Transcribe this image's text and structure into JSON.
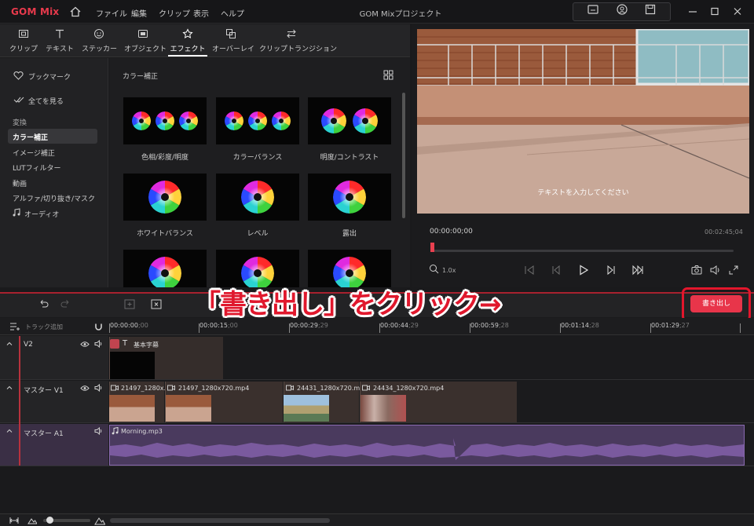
{
  "app": {
    "logo": "GOM Mix",
    "title": "GOM Mixプロジェクト"
  },
  "menu": [
    "ファイル",
    "編集",
    "クリップ",
    "表示",
    "ヘルプ"
  ],
  "tabs": [
    "クリップ",
    "テキスト",
    "ステッカー",
    "オブジェクト",
    "エフェクト",
    "オーバーレイ",
    "クリップトランジション"
  ],
  "sidebar": {
    "bookmark": "ブックマーク",
    "show_all": "全てを見る",
    "section": "変換",
    "items": [
      "カラー補正",
      "イメージ補正",
      "LUTフィルター",
      "動画",
      "アルファ/切り抜き/マスク",
      "オーディオ"
    ]
  },
  "grid": {
    "title": "カラー補正",
    "items": [
      "色相/彩度/明度",
      "カラーバランス",
      "明度/コントラスト",
      "ホワイトバランス",
      "レベル",
      "露出"
    ]
  },
  "preview": {
    "caption": "テキストを入力してください",
    "time_current": "00:00:00;00",
    "time_total": "00:02:45;04",
    "zoom": "1.0x",
    "playhead_fraction": 0
  },
  "timeline": {
    "add_track": "トラック追加",
    "export": "書き出し",
    "ruler": [
      {
        "main": "00:00:00",
        "sub": ";00"
      },
      {
        "main": "00:00:15",
        "sub": ";00"
      },
      {
        "main": "00:00:29",
        "sub": ";29"
      },
      {
        "main": "00:00:44",
        "sub": ";29"
      },
      {
        "main": "00:00:59",
        "sub": ";28"
      },
      {
        "main": "00:01:14",
        "sub": ";28"
      },
      {
        "main": "00:01:29",
        "sub": ";27"
      }
    ],
    "tracks": {
      "v2": {
        "name": "V2",
        "clip": "基本字幕"
      },
      "v1": {
        "name": "マスター V1",
        "clips": [
          "21497_1280x...",
          "21497_1280x720.mp4",
          "24431_1280x720.m...",
          "24434_1280x720.mp4"
        ]
      },
      "a1": {
        "name": "マスター A1",
        "clip": "Morning.mp3"
      }
    }
  },
  "annotation": "「書き出し」をクリック→",
  "colors": {
    "accent": "#e8354a",
    "audio": "#7a5a9e",
    "annotation": "#e0182d"
  }
}
